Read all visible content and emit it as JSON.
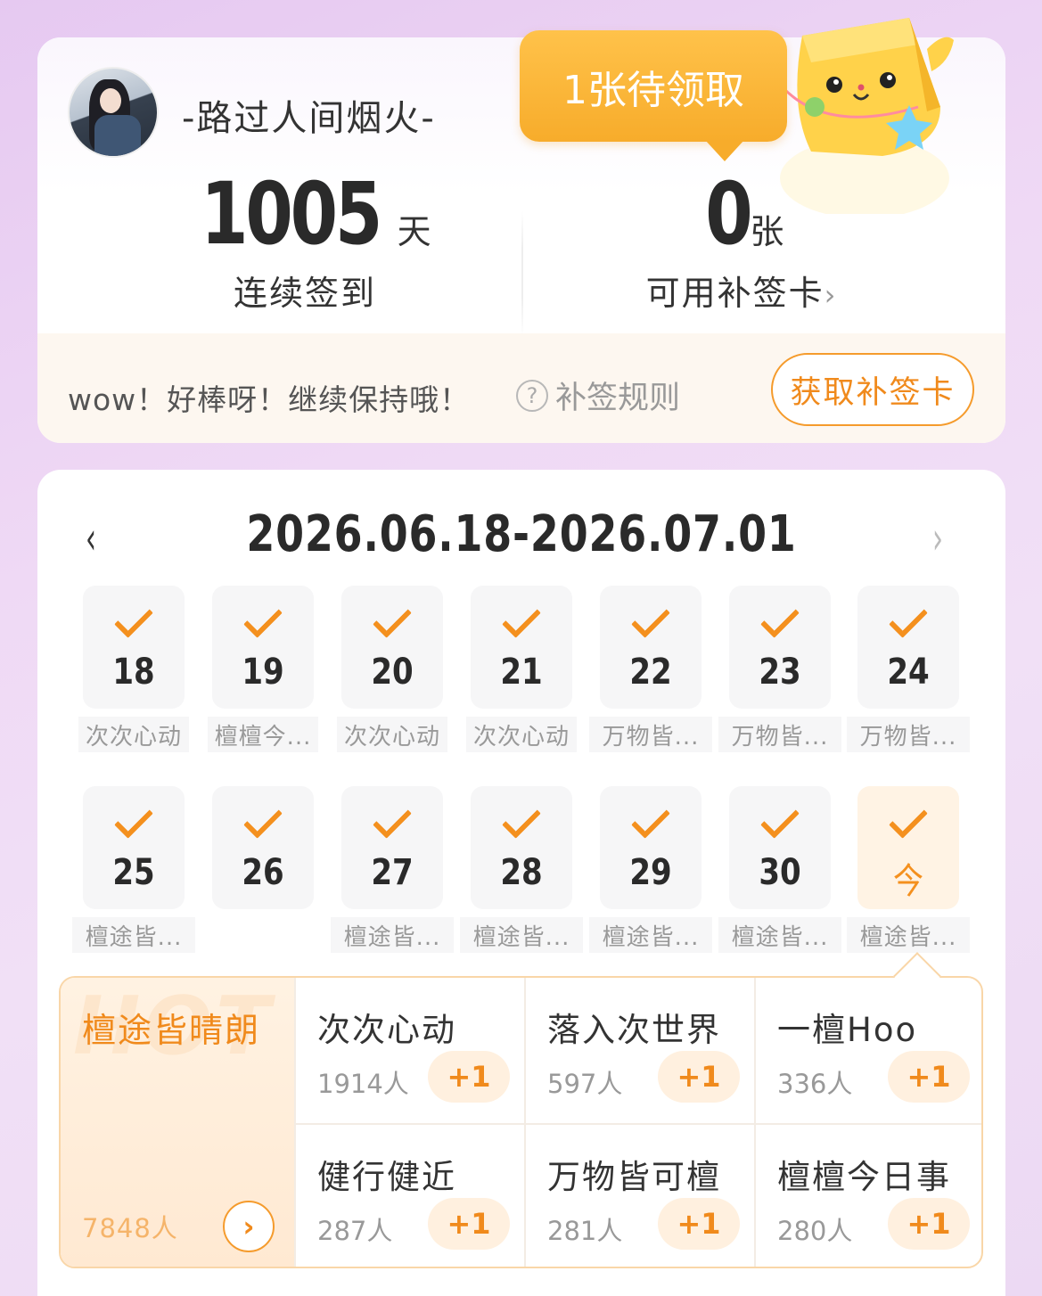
{
  "profile": {
    "username": "-路过人间烟火-"
  },
  "stats": {
    "streak_value": "1005",
    "streak_unit": "天",
    "streak_label": "连续签到",
    "cards_value": "0",
    "cards_unit": "张",
    "cards_label": "可用补签卡",
    "cards_chevron": "›"
  },
  "pending_tip": "1张待领取",
  "encourage_text": "wow！好棒呀！继续保持哦！",
  "rules_label": "补签规则",
  "rules_icon": "?",
  "get_card_button": "获取补签卡",
  "calendar": {
    "range": "2026.06.18-2026.07.01",
    "prev_icon": "‹",
    "next_icon": "›",
    "days": [
      {
        "num": "18",
        "tag": "次次心动"
      },
      {
        "num": "19",
        "tag": "檀檀今..."
      },
      {
        "num": "20",
        "tag": "次次心动"
      },
      {
        "num": "21",
        "tag": "次次心动"
      },
      {
        "num": "22",
        "tag": "万物皆..."
      },
      {
        "num": "23",
        "tag": "万物皆..."
      },
      {
        "num": "24",
        "tag": "万物皆..."
      },
      {
        "num": "25",
        "tag": "檀途皆..."
      },
      {
        "num": "26",
        "tag": ""
      },
      {
        "num": "27",
        "tag": "檀途皆..."
      },
      {
        "num": "28",
        "tag": "檀途皆..."
      },
      {
        "num": "29",
        "tag": "檀途皆..."
      },
      {
        "num": "30",
        "tag": "檀途皆..."
      },
      {
        "num": "今",
        "tag": "檀途皆..."
      }
    ]
  },
  "topics": {
    "hot": {
      "watermark": "HOT",
      "name": "檀途皆晴朗",
      "count": "7848人",
      "go_icon": "›"
    },
    "items": [
      {
        "name": "次次心动",
        "count": "1914人",
        "plus": "+1"
      },
      {
        "name": "落入次世界",
        "count": "597人",
        "plus": "+1"
      },
      {
        "name": "一檀Hoo",
        "count": "336人",
        "plus": "+1"
      },
      {
        "name": "健行健近",
        "count": "287人",
        "plus": "+1"
      },
      {
        "name": "万物皆可檀",
        "count": "281人",
        "plus": "+1"
      },
      {
        "name": "檀檀今日事",
        "count": "280人",
        "plus": "+1"
      }
    ]
  },
  "colors": {
    "accent": "#f4901e",
    "tip": "#f7ac2b",
    "background": "#ecd6f4"
  }
}
